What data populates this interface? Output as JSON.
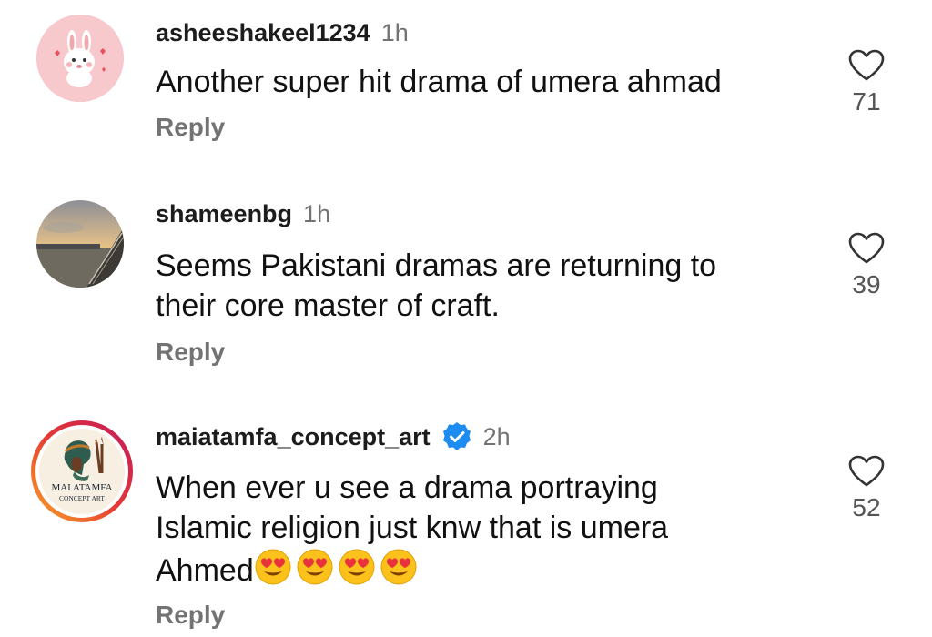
{
  "comments": [
    {
      "username": "asheeshakeel1234",
      "time": "1h",
      "text_lines": [
        "Another super hit drama of umera ahmad"
      ],
      "reply_label": "Reply",
      "likes": "71",
      "avatar": "cartoon-bunny-avatar",
      "verified": false
    },
    {
      "username": "shameenbg",
      "time": "1h",
      "text_lines": [
        "Seems Pakistani dramas are returning to",
        "their core master of craft."
      ],
      "reply_label": "Reply",
      "likes": "39",
      "avatar": "sunset-pier-photo-avatar",
      "verified": false
    },
    {
      "username": "maiatamfa_concept_art",
      "time": "2h",
      "text_lines": [
        "When ever u see a drama portraying",
        "Islamic religion just knw that is umera",
        "Ahmed"
      ],
      "emoji": "heart-eyes-emoji",
      "emoji_count": 4,
      "reply_label": "Reply",
      "likes": "52",
      "avatar": "mai-atamfa-logo-avatar",
      "avatar_text_1": "MAI ATAMFA",
      "avatar_text_2": "CONCEPT ART",
      "verified": true
    }
  ],
  "colors": {
    "username": "#1c1c1c",
    "secondary": "#737373",
    "verified_blue": "#1d8cf0",
    "bunny_bg": "#f8c9cc",
    "story_ring_start": "#f9a825",
    "story_ring_end": "#d81b60"
  }
}
